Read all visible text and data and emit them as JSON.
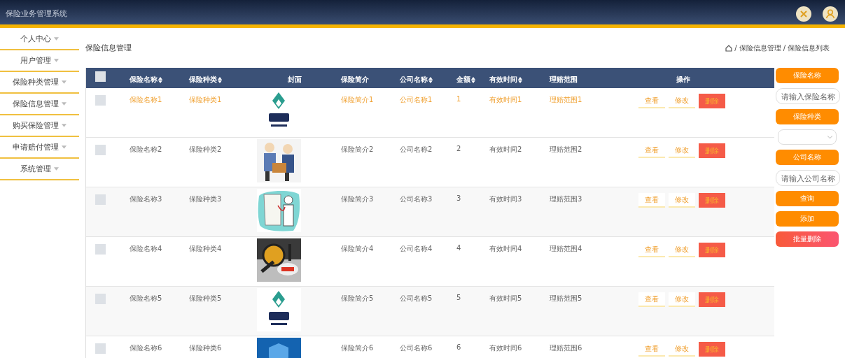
{
  "header": {
    "title": "保险业务管理系统"
  },
  "sidebar": {
    "items": [
      {
        "label": "个人中心"
      },
      {
        "label": "用户管理"
      },
      {
        "label": "保险种类管理"
      },
      {
        "label": "保险信息管理"
      },
      {
        "label": "购买保险管理"
      },
      {
        "label": "申请赔付管理"
      },
      {
        "label": "系统管理"
      }
    ]
  },
  "page_title": "保险信息管理",
  "breadcrumb": [
    {
      "separator": "/",
      "label": "保险信息管理"
    },
    {
      "separator": "/",
      "label": "保险信息列表"
    }
  ],
  "table": {
    "select_all_checked": false,
    "columns": [
      {
        "label": "保险名称",
        "sortable": true
      },
      {
        "label": "保险种类",
        "sortable": true
      },
      {
        "label": "封面",
        "sortable": false
      },
      {
        "label": "保险简介",
        "sortable": false
      },
      {
        "label": "公司名称",
        "sortable": true
      },
      {
        "label": "金额",
        "sortable": true
      },
      {
        "label": "有效时间",
        "sortable": true
      },
      {
        "label": "理赔范围",
        "sortable": false
      },
      {
        "label": "操作",
        "sortable": false
      }
    ],
    "rows": [
      {
        "selected": true,
        "checked": false,
        "cells": [
          "保险名称1",
          "保险种类1",
          {
            "kind": "picture"
          },
          "保险简介1",
          "公司名称1",
          "1",
          "有效时间1",
          "理赔范围1"
        ],
        "actions": [
          {
            "kind": "view",
            "label": "查看"
          },
          {
            "kind": "edit",
            "label": "修改"
          },
          {
            "kind": "delete",
            "label": "删除"
          }
        ]
      },
      {
        "selected": false,
        "checked": false,
        "cells": [
          "保险名称2",
          "保险种类2",
          {
            "kind": "picture"
          },
          "保险简介2",
          "公司名称2",
          "2",
          "有效时间2",
          "理赔范围2"
        ],
        "actions": [
          {
            "kind": "view",
            "label": "查看"
          },
          {
            "kind": "edit",
            "label": "修改"
          },
          {
            "kind": "delete",
            "label": "删除"
          }
        ]
      },
      {
        "selected": false,
        "checked": false,
        "cells": [
          "保险名称3",
          "保险种类3",
          {
            "kind": "picture"
          },
          "保险简介3",
          "公司名称3",
          "3",
          "有效时间3",
          "理赔范围3"
        ],
        "actions": [
          {
            "kind": "view",
            "label": "查看"
          },
          {
            "kind": "edit",
            "label": "修改"
          },
          {
            "kind": "delete",
            "label": "删除"
          }
        ]
      },
      {
        "selected": false,
        "checked": false,
        "cells": [
          "保险名称4",
          "保险种类4",
          {
            "kind": "picture"
          },
          "保险简介4",
          "公司名称4",
          "4",
          "有效时间4",
          "理赔范围4"
        ],
        "actions": [
          {
            "kind": "view",
            "label": "查看"
          },
          {
            "kind": "edit",
            "label": "修改"
          },
          {
            "kind": "delete",
            "label": "删除"
          }
        ]
      },
      {
        "selected": false,
        "checked": false,
        "cells": [
          "保险名称5",
          "保险种类5",
          {
            "kind": "picture"
          },
          "保险简介5",
          "公司名称5",
          "5",
          "有效时间5",
          "理赔范围5"
        ],
        "actions": [
          {
            "kind": "view",
            "label": "查看"
          },
          {
            "kind": "edit",
            "label": "修改"
          },
          {
            "kind": "delete",
            "label": "删除"
          }
        ]
      },
      {
        "selected": false,
        "checked": false,
        "cells": [
          "保险名称6",
          "保险种类6",
          {
            "kind": "picture"
          },
          "保险简介6",
          "公司名称6",
          "6",
          "有效时间6",
          "理赔范围6"
        ],
        "actions": [
          {
            "kind": "view",
            "label": "查看"
          },
          {
            "kind": "edit",
            "label": "修改"
          },
          {
            "kind": "delete",
            "label": "删除"
          }
        ]
      }
    ]
  },
  "filters": [
    {
      "kind": "label",
      "label": "保险名称"
    },
    {
      "kind": "input",
      "placeholder": "请输入保险名称"
    },
    {
      "kind": "label",
      "label": "保险种类"
    },
    {
      "kind": "select"
    },
    {
      "kind": "label",
      "label": "公司名称"
    },
    {
      "kind": "input",
      "placeholder": "请输入公司名称"
    },
    {
      "kind": "button",
      "label": "查询"
    },
    {
      "kind": "button",
      "label": "添加"
    },
    {
      "kind": "danger",
      "label": "批量删除"
    }
  ]
}
